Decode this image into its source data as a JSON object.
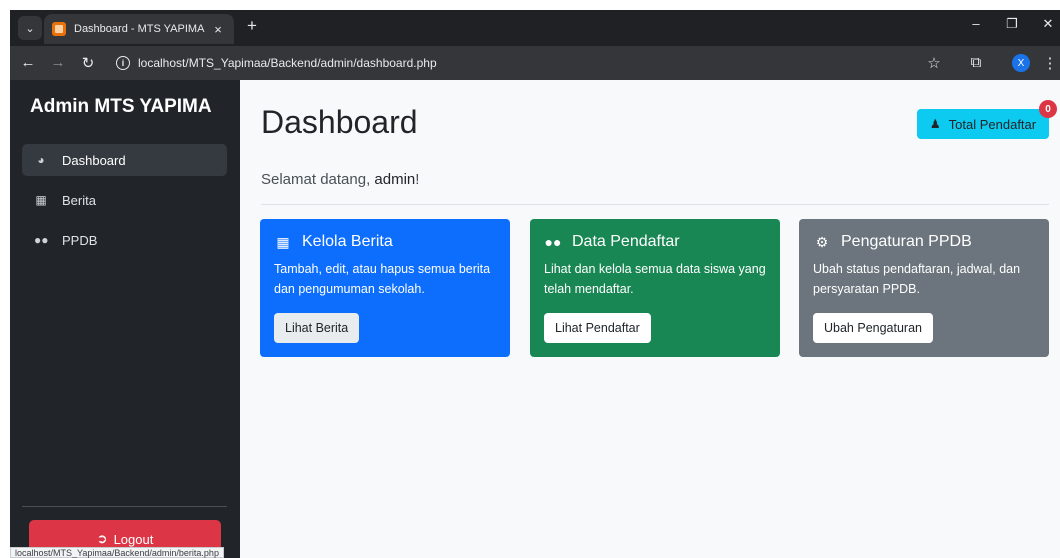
{
  "browser": {
    "tab_title": "Dashboard - MTS YAPIMA",
    "tab_close": "×",
    "new_tab": "+",
    "url": "localhost/MTS_Yapimaa/Backend/admin/dashboard.php",
    "profile_initial": "X",
    "status_url": "localhost/MTS_Yapimaa/Backend/admin/berita.php",
    "icons": [
      "chevron-down-icon",
      "back-arrow-icon",
      "forward-arrow-icon",
      "reload-icon",
      "info-icon",
      "star-icon",
      "extensions-icon",
      "menu-icon",
      "minimize-icon",
      "restore-icon",
      "close-icon"
    ]
  },
  "sidebar": {
    "brand": "Admin MTS YAPIMA",
    "items": [
      {
        "label": "Dashboard",
        "icon": "gauge-icon",
        "active": true
      },
      {
        "label": "Berita",
        "icon": "newspaper-icon",
        "active": false
      },
      {
        "label": "PPDB",
        "icon": "users-icon",
        "active": false
      }
    ],
    "logout_label": "Logout"
  },
  "main": {
    "title": "Dashboard",
    "total_button_label": "Total Pendaftar",
    "total_badge": "0",
    "welcome_prefix": "Selamat datang, ",
    "welcome_user": "admin",
    "welcome_suffix": "!",
    "cards": [
      {
        "title": "Kelola Berita",
        "icon": "newspaper-icon",
        "text": "Tambah, edit, atau hapus semua berita dan pengumuman sekolah.",
        "button": "Lihat Berita"
      },
      {
        "title": "Data Pendaftar",
        "icon": "users-icon",
        "text": "Lihat dan kelola semua data siswa yang telah mendaftar.",
        "button": "Lihat Pendaftar"
      },
      {
        "title": "Pengaturan PPDB",
        "icon": "gear-icon",
        "text": "Ubah status pendaftaran, jadwal, dan persyaratan PPDB.",
        "button": "Ubah Pengaturan"
      }
    ]
  },
  "colors": {
    "sidebar_bg": "#212529",
    "main_bg": "#f8f9fa",
    "blue": "#0d6efd",
    "green": "#198754",
    "gray": "#6c757d",
    "info": "#0dcaf0",
    "danger": "#dc3545"
  }
}
